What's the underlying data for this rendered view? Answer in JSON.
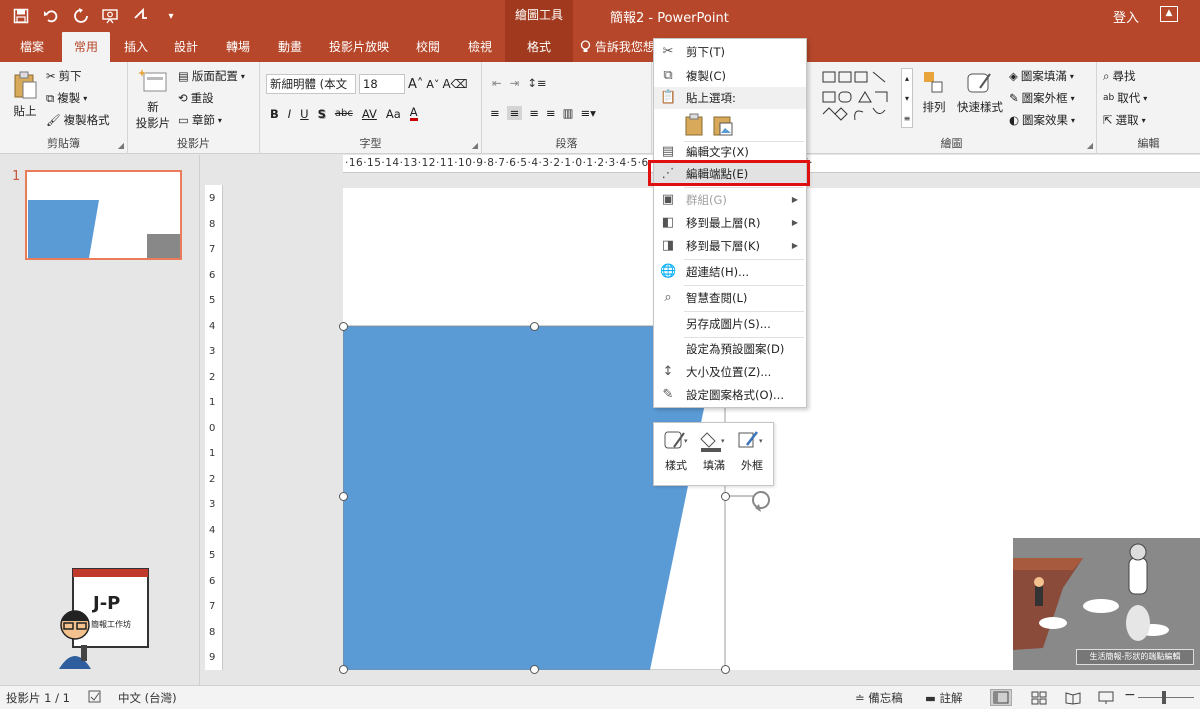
{
  "titlebar": {
    "contextual_group": "繪圖工具",
    "doc_title": "簡報2 - PowerPoint",
    "signin": "登入"
  },
  "tabs": [
    {
      "label": "檔案"
    },
    {
      "label": "常用"
    },
    {
      "label": "插入"
    },
    {
      "label": "設計"
    },
    {
      "label": "轉場"
    },
    {
      "label": "動畫"
    },
    {
      "label": "投影片放映"
    },
    {
      "label": "校閱"
    },
    {
      "label": "檢視"
    },
    {
      "label": "格式"
    }
  ],
  "tell_me": "告訴我您想",
  "ribbon": {
    "clipboard": {
      "paste": "貼上",
      "cut": "剪下",
      "copy": "複製",
      "format_painter": "複製格式",
      "label": "剪貼簿"
    },
    "slides": {
      "new_slide_1": "新",
      "new_slide_2": "投影片",
      "layout": "版面配置",
      "reset": "重設",
      "section": "章節",
      "label": "投影片"
    },
    "font": {
      "font_name": "新細明體 (本文",
      "font_size": "18",
      "label": "字型",
      "bold": "B",
      "italic": "I",
      "underline": "U",
      "shadow": "S",
      "strike": "abc",
      "spacing": "AV",
      "case": "Aa",
      "color": "A"
    },
    "paragraph": {
      "label": "段落"
    },
    "drawing": {
      "arrange": "排列",
      "quick_styles": "快速樣式",
      "fill": "圖案填滿",
      "outline": "圖案外框",
      "effects": "圖案效果",
      "label": "繪圖"
    },
    "editing": {
      "find": "尋找",
      "replace": "取代",
      "select": "選取",
      "label": "編輯"
    }
  },
  "thumbnail": {
    "number": "1"
  },
  "logo_text": {
    "initials": "J-P",
    "name": "簡報工作坊"
  },
  "ruler": {
    "h_ticks": "·16·15·14·13·12·11·10·9·8·7·6·5·4·3·2·1·0·1·2·3·4·5·6·7·8·9·10·11·12·13·14·15·16·",
    "v_ticks": [
      "9",
      "8",
      "7",
      "6",
      "5",
      "4",
      "3",
      "2",
      "1",
      "0",
      "1",
      "2",
      "3",
      "4",
      "5",
      "6",
      "7",
      "8",
      "9"
    ]
  },
  "context_menu": {
    "cut": "剪下(T)",
    "copy": "複製(C)",
    "paste_options": "貼上選項:",
    "edit_text": "編輯文字(X)",
    "edit_points": "編輯端點(E)",
    "group": "群組(G)",
    "bring_front": "移到最上層(R)",
    "send_back": "移到最下層(K)",
    "hyperlink": "超連結(H)...",
    "smart_lookup": "智慧查閱(L)",
    "save_as_picture": "另存成圖片(S)...",
    "set_default": "設定為預設圖案(D)",
    "size_position": "大小及位置(Z)...",
    "format_shape": "設定圖案格式(O)..."
  },
  "mini_toolbar": {
    "style": "樣式",
    "fill": "填滿",
    "outline": "外框"
  },
  "corner_picture": {
    "caption": "生活簡報-形狀的端點編輯"
  },
  "statusbar": {
    "slide_info": "投影片 1 / 1",
    "language": "中文 (台灣)",
    "notes": "備忘稿",
    "comments": "註解"
  },
  "colors": {
    "accent": "#b7472a",
    "shape_fill": "#5b9bd5",
    "highlight": "#e01010"
  }
}
